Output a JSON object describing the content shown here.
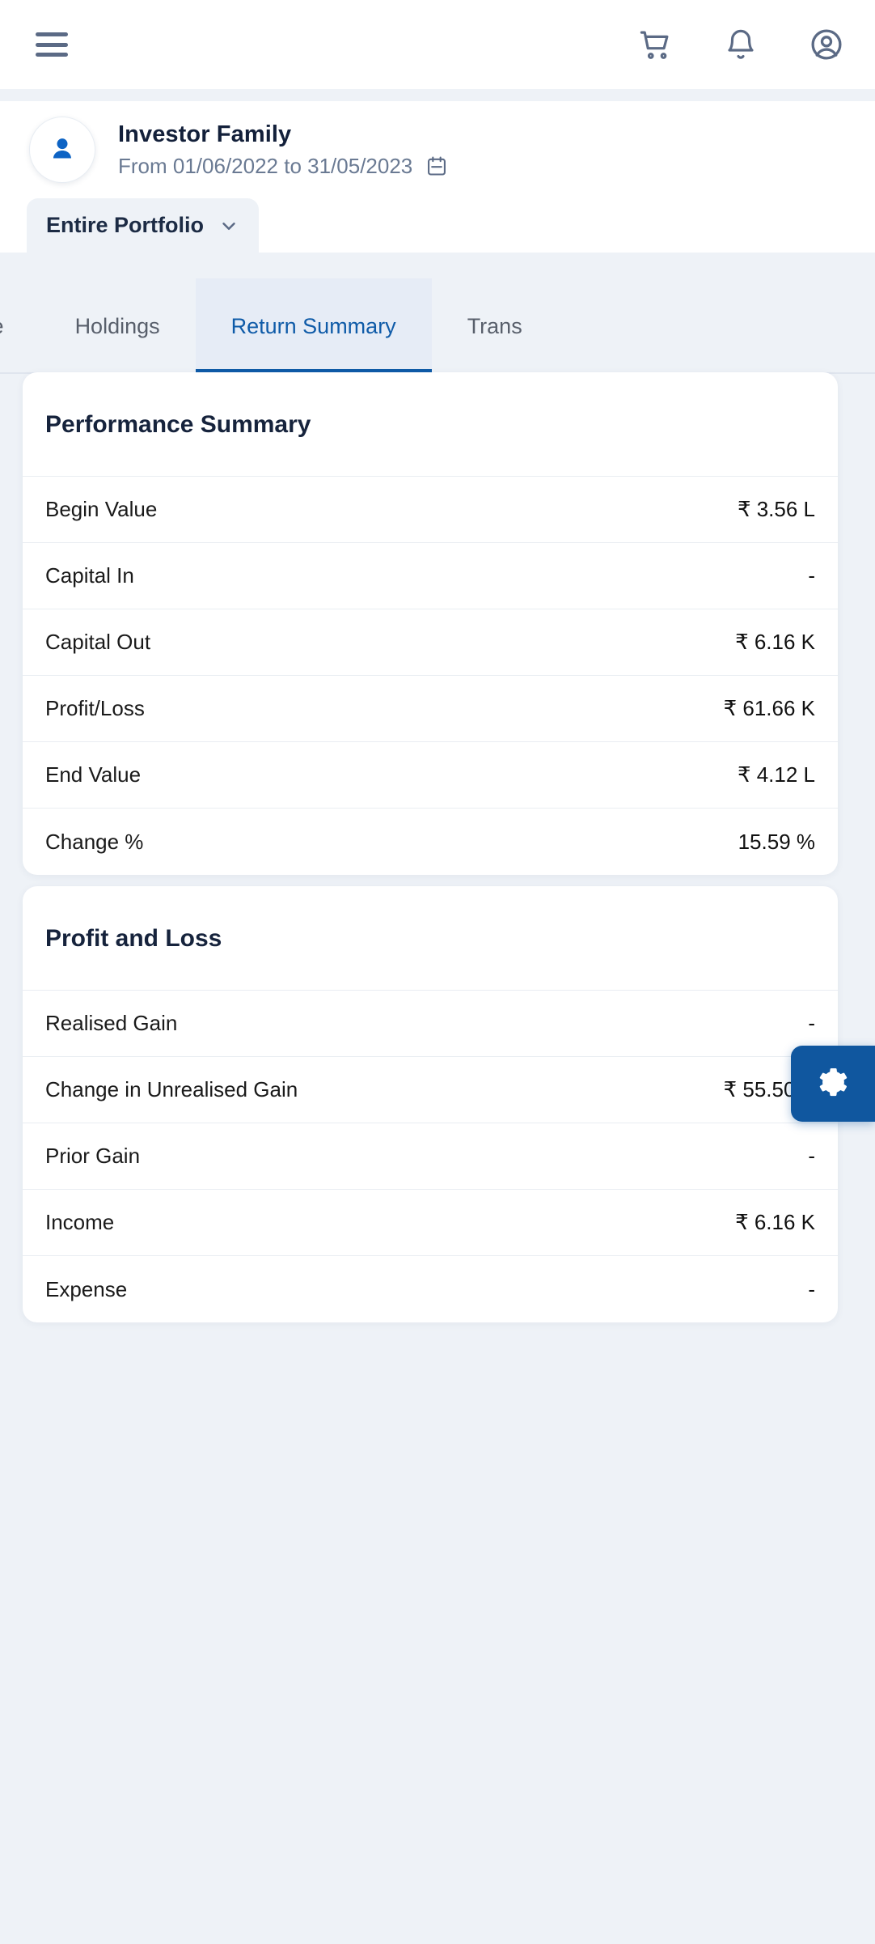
{
  "appbar": {
    "menu_icon": "hamburger-menu-icon",
    "icons": [
      {
        "name": "shopping-cart-icon",
        "label": "Cart"
      },
      {
        "name": "notification-bell-icon",
        "label": "Notifications"
      },
      {
        "name": "user-account-icon",
        "label": "Account"
      }
    ]
  },
  "investor": {
    "avatar_icon": "user-avatar-icon",
    "name": "Investor Family",
    "date_range": "From 01/06/2022 to 31/05/2023",
    "calendar_icon": "calendar-icon"
  },
  "portfolio_selector": {
    "label": "Entire Portfolio",
    "chevron_icon": "chevron-down-icon"
  },
  "tabs": [
    {
      "label": "ance",
      "active": false
    },
    {
      "label": "Holdings",
      "active": false
    },
    {
      "label": "Return Summary",
      "active": true
    },
    {
      "label": "Trans",
      "active": false
    }
  ],
  "performance_summary": {
    "title": "Performance Summary",
    "rows": [
      {
        "label": "Begin Value",
        "value": "₹ 3.56 L"
      },
      {
        "label": "Capital In",
        "value": "-"
      },
      {
        "label": "Capital Out",
        "value": "₹ 6.16 K"
      },
      {
        "label": "Profit/Loss",
        "value": "₹ 61.66 K"
      },
      {
        "label": "End Value",
        "value": "₹ 4.12 L"
      },
      {
        "label": "Change %",
        "value": "15.59 %"
      }
    ]
  },
  "profit_and_loss": {
    "title": "Profit and Loss",
    "rows": [
      {
        "label": "Realised Gain",
        "value": "-"
      },
      {
        "label": "Change in Unrealised Gain",
        "value": "₹ 55.50 K"
      },
      {
        "label": "Prior Gain",
        "value": "-"
      },
      {
        "label": "Income",
        "value": "₹ 6.16 K"
      },
      {
        "label": "Expense",
        "value": "-"
      }
    ]
  },
  "settings_fab": {
    "icon": "gear-icon",
    "color": "#10579f"
  },
  "colors": {
    "page_background": "#eef2f7",
    "card_background": "#ffffff",
    "accent": "#0f5ba8",
    "muted_text": "#6a7a93",
    "heading_text": "#16233c"
  }
}
